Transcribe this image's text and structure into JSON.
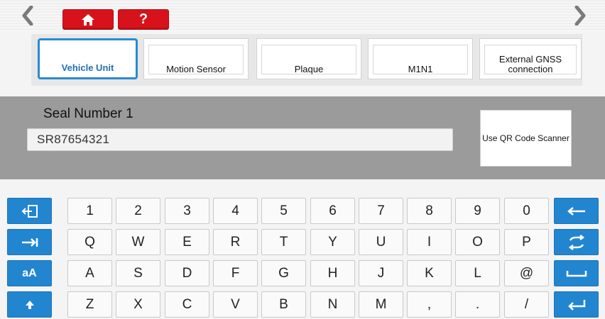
{
  "top_buttons": {
    "help_label": "?"
  },
  "tabs": [
    {
      "label": "Vehicle Unit"
    },
    {
      "label": "Motion Sensor"
    },
    {
      "label": "Plaque"
    },
    {
      "label": "M1N1"
    },
    {
      "label": "External GNSS connection"
    }
  ],
  "seal": {
    "label": "Seal Number 1",
    "value": "SR87654321",
    "qr_button_label": "Use QR Code Scanner"
  },
  "keyboard": {
    "row1": [
      "1",
      "2",
      "3",
      "4",
      "5",
      "6",
      "7",
      "8",
      "9",
      "0"
    ],
    "row2": [
      "Q",
      "W",
      "E",
      "R",
      "T",
      "Y",
      "U",
      "I",
      "O",
      "P"
    ],
    "row3": [
      "A",
      "S",
      "D",
      "F",
      "G",
      "H",
      "J",
      "K",
      "L",
      "@"
    ],
    "row4": [
      "Z",
      "X",
      "C",
      "V",
      "B",
      "N",
      "M",
      ",",
      ".",
      "/"
    ],
    "case_toggle_label": "aA"
  },
  "colors": {
    "accent_red": "#d8121b",
    "accent_blue": "#2285d0",
    "panel_gray": "#9b9b9b"
  }
}
